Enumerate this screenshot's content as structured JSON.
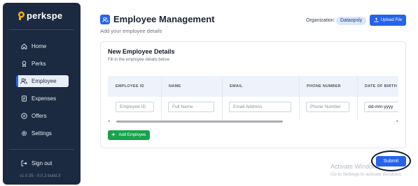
{
  "brand": {
    "name": "perkspe"
  },
  "sidebar": {
    "items": [
      {
        "label": "Home",
        "icon": "home-icon"
      },
      {
        "label": "Perks",
        "icon": "award-icon"
      },
      {
        "label": "Employee",
        "icon": "users-icon",
        "active": true
      },
      {
        "label": "Expenses",
        "icon": "receipt-icon"
      },
      {
        "label": "Offers",
        "icon": "badge-percent-icon"
      },
      {
        "label": "Settings",
        "icon": "gear-icon"
      }
    ],
    "sign_out": "Sign out",
    "version": "v1.0.35 - 0.0.2-build.3"
  },
  "header": {
    "title": "Employee Management",
    "subtitle": "Add your employee details",
    "org_label": "Organization:",
    "org_name": "Dataopsly",
    "upload_label": "Upload File"
  },
  "card": {
    "title": "New Employee Details",
    "subtitle": "Fill in the employee details below",
    "columns": [
      "EMPLOYEE ID",
      "NAME",
      "EMAIL",
      "PHONE NUMBER",
      "DATE OF BIRTH"
    ],
    "placeholders": [
      "Employee ID",
      "Full Name",
      "Email Address",
      "Phone Number"
    ],
    "date_value": "dd-mm-yyyy",
    "add_label": "Add Employee"
  },
  "submit_label": "Submit",
  "watermark": {
    "line1": "Activate Windows",
    "line2": "Go to Settings to activate Windows."
  },
  "colors": {
    "sidebar": "#1b2a40",
    "accent": "#2563eb",
    "add": "#16a34a"
  }
}
